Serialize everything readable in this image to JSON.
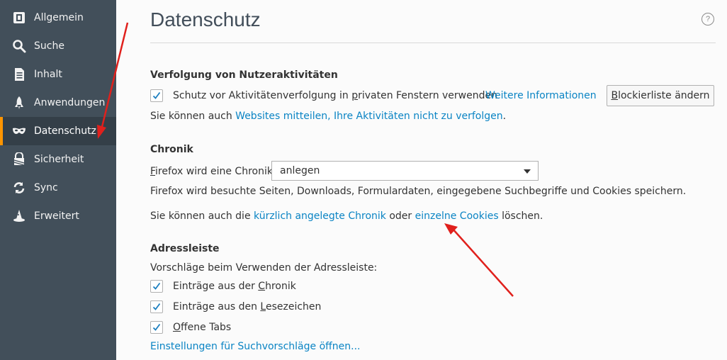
{
  "sidebar": {
    "items": [
      {
        "label": "Allgemein",
        "icon": "general-icon"
      },
      {
        "label": "Suche",
        "icon": "search-icon"
      },
      {
        "label": "Inhalt",
        "icon": "document-icon"
      },
      {
        "label": "Anwendungen",
        "icon": "rocket-icon"
      },
      {
        "label": "Datenschutz",
        "icon": "mask-icon",
        "selected": true
      },
      {
        "label": "Sicherheit",
        "icon": "security-icon"
      },
      {
        "label": "Sync",
        "icon": "sync-icon"
      },
      {
        "label": "Erweitert",
        "icon": "wizard-hat-icon"
      }
    ]
  },
  "page": {
    "title": "Datenschutz",
    "help": "?"
  },
  "tracking": {
    "heading": "Verfolgung von Nutzeraktivitäten",
    "checkbox": {
      "checked": true,
      "pre": "Schutz vor Aktivitätenverfolgung in ",
      "access": "p",
      "post": "rivaten Fenstern verwenden"
    },
    "more_info_link": "Weitere Informationen",
    "block_button": {
      "access": "B",
      "rest": "lockierliste ändern"
    },
    "dnt_text_pre": "Sie können auch ",
    "dnt_link": "Websites mitteilen, Ihre Aktivitäten nicht zu verfolgen",
    "dnt_text_post": "."
  },
  "history": {
    "heading": "Chronik",
    "label": {
      "access": "F",
      "rest": "irefox wird eine Chronik:"
    },
    "select_value": "anlegen",
    "description": "Firefox wird besuchte Seiten, Downloads, Formulardaten, eingegebene Suchbegriffe und Cookies speichern.",
    "clear_pre": "Sie können auch die ",
    "clear_link_history": "kürzlich angelegte Chronik",
    "clear_mid": " oder ",
    "clear_link_cookies": "einzelne Cookies",
    "clear_post": " löschen."
  },
  "addressbar": {
    "heading": "Adressleiste",
    "intro": "Vorschläge beim Verwenden der Adressleiste:",
    "options": [
      {
        "pre": "Einträge aus der ",
        "access": "C",
        "post": "hronik",
        "checked": true
      },
      {
        "pre": "Einträge aus den ",
        "access": "L",
        "post": "esezeichen",
        "checked": true
      },
      {
        "pre": "",
        "access": "O",
        "post": "ffene Tabs",
        "checked": true
      }
    ],
    "suggest_link": "Einstellungen für Suchvorschläge öffnen..."
  },
  "colors": {
    "sidebar_bg": "#424f5a",
    "sidebar_selected": "#343f48",
    "accent": "#ff9500",
    "link": "#0a84c4",
    "annotation_arrow": "#e0201c"
  }
}
